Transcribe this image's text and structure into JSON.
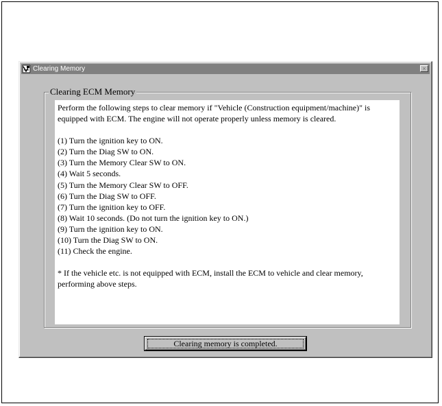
{
  "window": {
    "title": "Clearing Memory",
    "icon": "app-tool-icon",
    "close_glyph": "×"
  },
  "group": {
    "legend": "Clearing ECM Memory",
    "intro": "Perform the following steps to clear memory if \"Vehicle (Construction equipment/machine)\" is equipped with ECM. The engine will not operate properly unless memory is cleared.",
    "steps": [
      "(1) Turn the ignition key to ON.",
      "(2) Turn the Diag SW to ON.",
      "(3) Turn the Memory Clear SW to ON.",
      "(4) Wait 5 seconds.",
      "(5) Turn the Memory Clear SW to OFF.",
      "(6) Turn the Diag SW to OFF.",
      "(7) Turn the ignition key to OFF.",
      "(8) Wait 10 seconds. (Do not turn the ignition key to ON.)",
      "(9) Turn the ignition key to ON.",
      "(10) Turn the Diag SW to ON.",
      "(11) Check the engine."
    ],
    "note": "* If the vehicle etc. is not equipped with ECM, install the ECM to vehicle and clear memory, performing above steps."
  },
  "button": {
    "label": "Clearing memory is completed."
  }
}
